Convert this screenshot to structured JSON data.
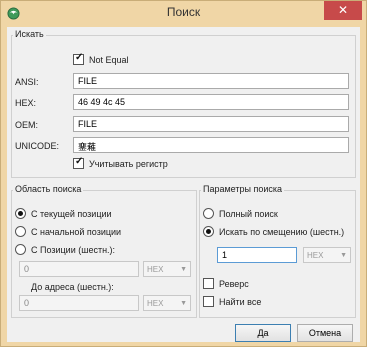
{
  "window": {
    "title": "Поиск",
    "close_glyph": "✕",
    "icon_name": "app-globe-icon"
  },
  "search": {
    "group_label": "Искать",
    "not_equal_label": "Not Equal",
    "not_equal_checked": true,
    "fields": [
      {
        "label": "ANSI:",
        "value": "FILE"
      },
      {
        "label": "HEX:",
        "value": "46 49 4c 45"
      },
      {
        "label": "OEM:",
        "value": "FILE"
      },
      {
        "label": "UNICODE:",
        "value": "䥆䕌"
      }
    ],
    "case_label": "Учитывать регистр",
    "case_checked": true
  },
  "area": {
    "title": "Область поиска",
    "options": [
      "С текущей позиции",
      "С начальной позиции",
      "С Позиции (шестн.):"
    ],
    "selected": 0,
    "from_value": "0",
    "from_unit": "HEX",
    "to_label": "До адреса (шестн.):",
    "to_value": "0",
    "to_unit": "HEX"
  },
  "params": {
    "title": "Параметры поиска",
    "options": [
      "Полный поиск",
      "Искать по смещению (шестн.)"
    ],
    "selected": 1,
    "offset_value": "1",
    "offset_unit": "HEX",
    "reverse_label": "Реверс",
    "reverse_checked": false,
    "find_all_label": "Найти все",
    "find_all_checked": false
  },
  "buttons": {
    "ok": "Да",
    "cancel": "Отмена"
  },
  "colors": {
    "frame": "#f0d6a6",
    "close": "#c74a4a",
    "client": "#f0f0f0",
    "focus": "#5b9bd5"
  }
}
